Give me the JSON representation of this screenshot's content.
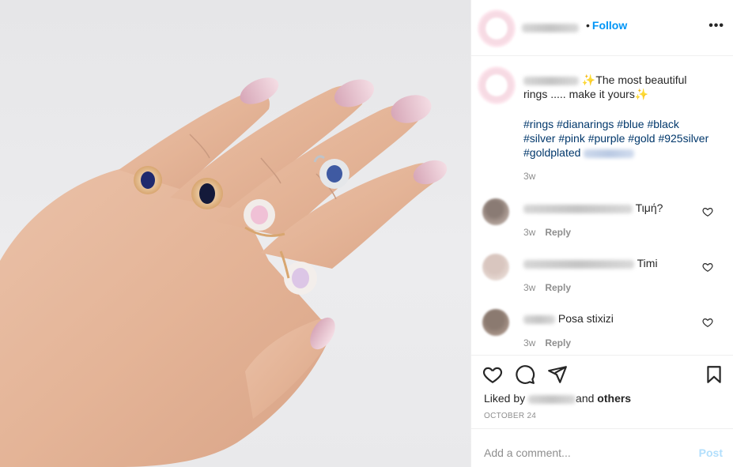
{
  "header": {
    "follow_separator": "•",
    "follow_label": "Follow",
    "more_label": "•••"
  },
  "caption": {
    "text_part1": "The most beautiful",
    "text_part2": "rings ..... make it yours",
    "hashtags_line1": "#rings #dianarings #blue #black",
    "hashtags_line2": "#silver #pink #purple #gold #925silver",
    "hashtags_line3": "#goldplated",
    "time": "3w",
    "sparkle": "✨"
  },
  "comments": [
    {
      "text": "Τιμή?",
      "time": "3w",
      "reply_label": "Reply"
    },
    {
      "text": "Timi",
      "time": "3w",
      "reply_label": "Reply"
    },
    {
      "text": "Posa stixizi",
      "time": "3w",
      "reply_label": "Reply"
    }
  ],
  "actions": {
    "liked_prefix": "Liked by",
    "liked_suffix_and": "and",
    "liked_others": "others",
    "date": "OCTOBER 24"
  },
  "add_comment": {
    "placeholder": "Add a comment...",
    "post_label": "Post"
  },
  "colors": {
    "link_blue": "#0095f6",
    "hashtag_blue": "#00376b",
    "muted": "#8e8e8e",
    "post_disabled": "#b2dffc"
  }
}
